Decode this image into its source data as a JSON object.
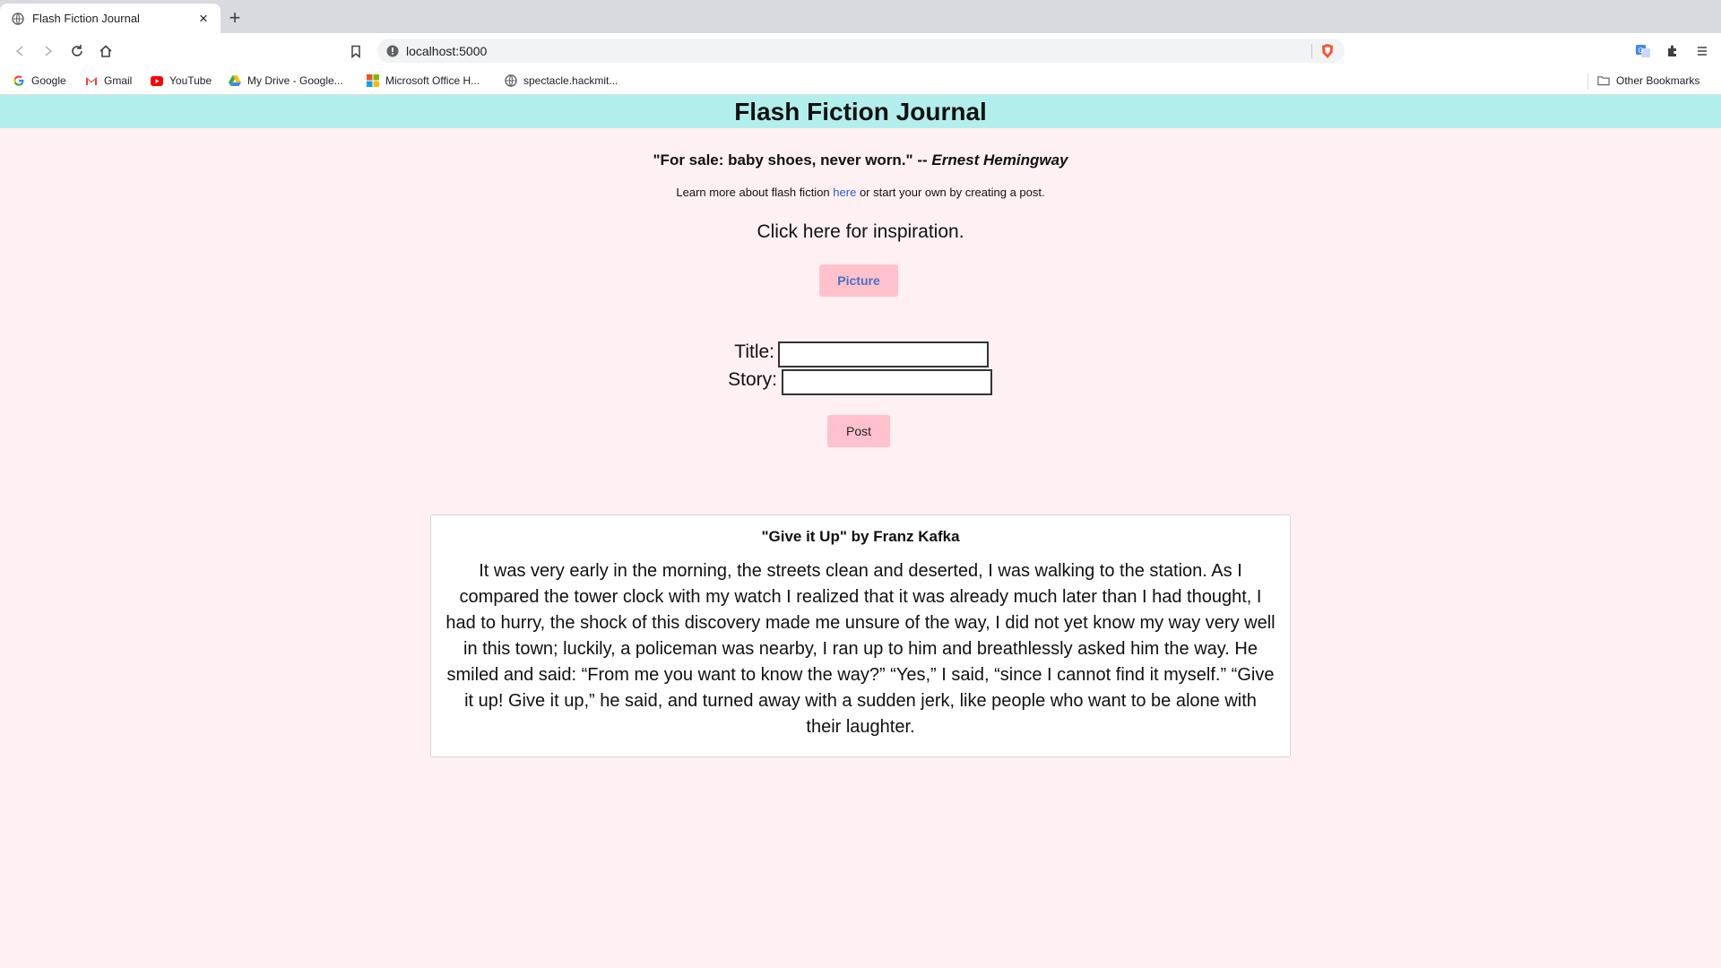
{
  "browser": {
    "tab_title": "Flash Fiction Journal",
    "url": "localhost:5000",
    "bookmarks": [
      {
        "label": "Google",
        "icon": "google-icon"
      },
      {
        "label": "Gmail",
        "icon": "gmail-icon"
      },
      {
        "label": "YouTube",
        "icon": "youtube-icon"
      },
      {
        "label": "My Drive - Google...",
        "icon": "drive-icon"
      },
      {
        "label": "Microsoft Office H...",
        "icon": "microsoft-icon"
      },
      {
        "label": "spectacle.hackmit...",
        "icon": "globe-icon"
      }
    ],
    "other_bookmarks": "Other Bookmarks"
  },
  "page": {
    "title": "Flash Fiction Journal",
    "quote_text": "\"For sale: baby shoes, never worn.\" --",
    "quote_author": "Ernest Hemingway",
    "learn_before": "Learn more about flash fiction",
    "learn_link": "here",
    "learn_after": "or start your own by creating a post.",
    "inspiration": "Click here for inspiration.",
    "picture_button": "Picture",
    "form": {
      "title_label": "Title:",
      "title_value": "",
      "story_label": "Story:",
      "story_value": "",
      "post_button": "Post"
    },
    "story": {
      "heading": "\"Give it Up\" by Franz Kafka",
      "body": "It was very early in the morning, the streets clean and deserted, I was walking to the station. As I compared the tower clock with my watch I realized that it was already much later than I had thought, I had to hurry, the shock of this discovery made me unsure of the way, I did not yet know my way very well in this town; luckily, a policeman was nearby, I ran up to him and breathlessly asked him the way. He smiled and said: “From me you want to know the way?”  “Yes,” I said, “since I cannot find it myself.”  “Give it up! Give it up,” he said, and turned away with a sudden jerk, like people who want to be alone with their laughter."
    }
  },
  "colors": {
    "header_bg": "#b2efec",
    "page_bg": "#fff0f4",
    "button_bg": "#ffc2cc",
    "link": "#2a5bd7"
  }
}
